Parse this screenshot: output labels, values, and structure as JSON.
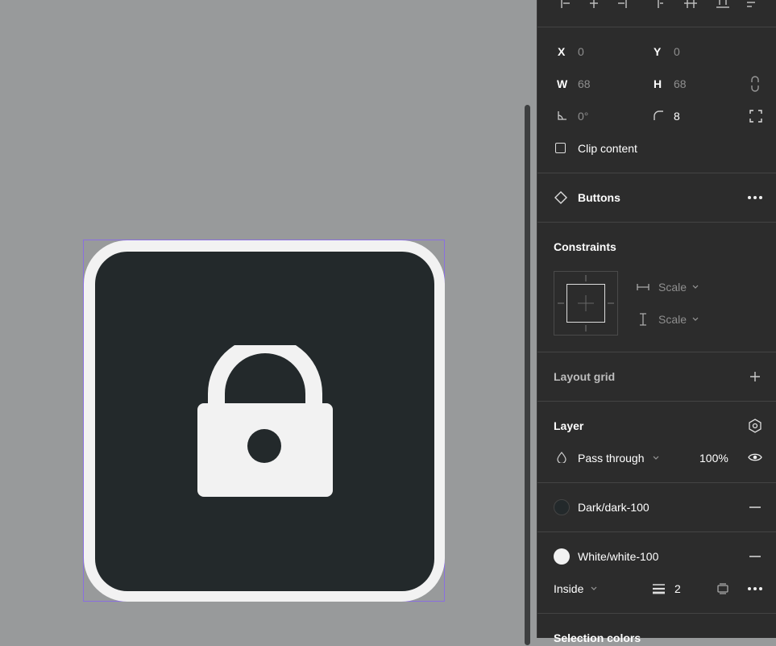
{
  "transform": {
    "x_label": "X",
    "x_value": "0",
    "y_label": "Y",
    "y_value": "0",
    "w_label": "W",
    "w_value": "68",
    "h_label": "H",
    "h_value": "68",
    "rotation_value": "0°",
    "radius_value": "8",
    "clip_content_label": "Clip content"
  },
  "component": {
    "name": "Buttons"
  },
  "constraints": {
    "title": "Constraints",
    "horizontal": "Scale",
    "vertical": "Scale"
  },
  "layout_grid": {
    "title": "Layout grid"
  },
  "layer": {
    "title": "Layer",
    "blend_mode": "Pass through",
    "opacity": "100%"
  },
  "fills": [
    {
      "name": "Dark/dark-100",
      "color": "#23292b"
    },
    {
      "name": "White/white-100",
      "color": "#f2f2f2"
    }
  ],
  "stroke": {
    "position": "Inside",
    "weight": "2"
  },
  "selection_colors": {
    "title": "Selection colors"
  },
  "colors": {
    "canvas": "#989a9b",
    "panel": "#2c2c2c",
    "selection": "#8a6fe0"
  }
}
